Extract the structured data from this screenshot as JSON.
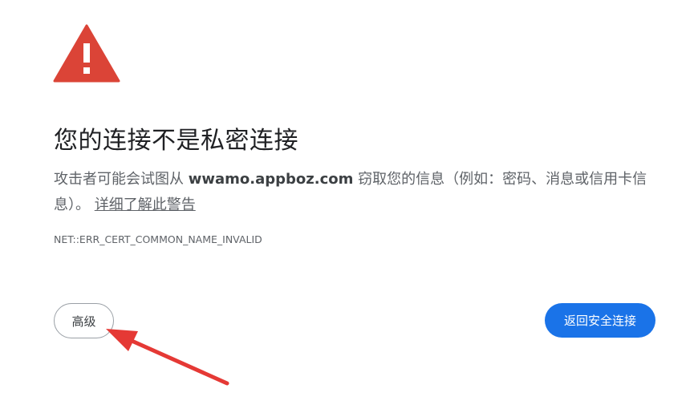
{
  "page": {
    "icon": "warning-triangle-icon",
    "title": "您的连接不是私密连接",
    "description_before": "攻击者可能会试图从 ",
    "domain": "wwamo.appboz.com",
    "description_after": " 窃取您的信息（例如：密码、消息或信用卡信息）。",
    "learn_more": "详细了解此警告",
    "error_code": "NET::ERR_CERT_COMMON_NAME_INVALID"
  },
  "buttons": {
    "advanced": "高级",
    "back_to_safety": "返回安全连接"
  },
  "annotation": {
    "arrow": "red-arrow-icon"
  },
  "colors": {
    "warning_red": "#db4437",
    "primary_blue": "#1a73e8",
    "arrow_red": "#e53935"
  }
}
